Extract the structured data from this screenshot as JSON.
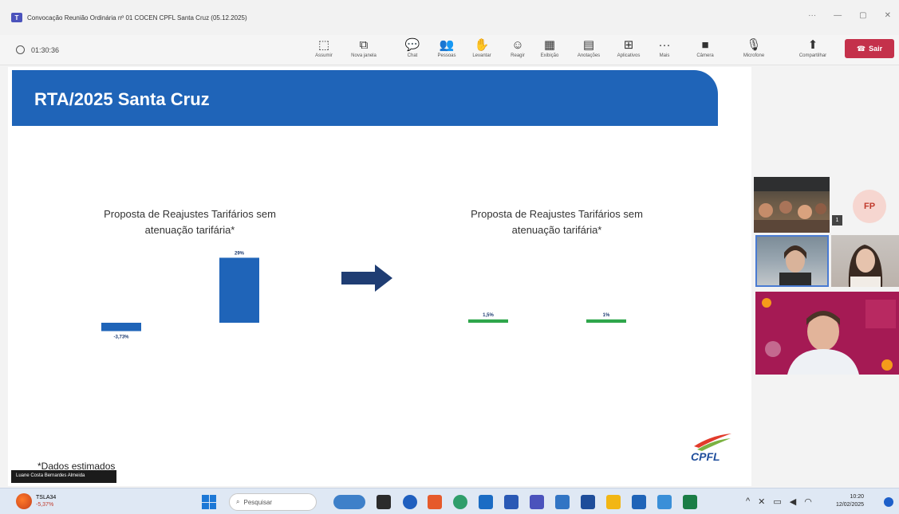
{
  "window": {
    "title": "Convocação Reunião Ordinária nº 01 COCEN CPFL Santa Cruz (05.12.2025)"
  },
  "toolbar": {
    "timer": "01:30:36",
    "items": [
      {
        "label": "Assumir",
        "icon": "share-screen-icon",
        "glyph": "⬚"
      },
      {
        "label": "Nova janela",
        "icon": "new-window-icon",
        "glyph": "⧉"
      },
      {
        "label": "Chat",
        "icon": "chat-icon",
        "glyph": "💬"
      },
      {
        "label": "Pessoas",
        "icon": "people-icon",
        "glyph": "👥"
      },
      {
        "label": "Levantar",
        "icon": "raise-hand-icon",
        "glyph": "✋"
      },
      {
        "label": "Reagir",
        "icon": "react-icon",
        "glyph": "☺"
      },
      {
        "label": "Exibição",
        "icon": "view-icon",
        "glyph": "▦"
      },
      {
        "label": "Anotações",
        "icon": "notes-icon",
        "glyph": "▤"
      },
      {
        "label": "Aplicativos",
        "icon": "apps-icon",
        "glyph": "⊞"
      },
      {
        "label": "Mais",
        "icon": "more-icon",
        "glyph": "···"
      },
      {
        "label": "Câmera",
        "icon": "camera-icon",
        "glyph": "■"
      },
      {
        "label": "Microfone",
        "icon": "microphone-icon",
        "glyph": "🎙"
      },
      {
        "label": "Compartilhar",
        "icon": "share-icon",
        "glyph": "⬆"
      }
    ],
    "leave_label": "Sair"
  },
  "slide": {
    "title": "RTA/2025 Santa Cruz",
    "footnote": "*Dados estimados"
  },
  "chart_data": [
    {
      "type": "bar",
      "title_line1": "Proposta de Reajustes Tarifários sem",
      "title_line2": "atenuação tarifária*",
      "categories": [
        "",
        ""
      ],
      "values": [
        -3.73,
        29
      ],
      "value_labels": [
        "-3,73%",
        "29%"
      ],
      "colors": [
        "#1f64b8",
        "#1f64b8"
      ],
      "ylim": [
        -6,
        32
      ]
    },
    {
      "type": "bar",
      "title_line1": "Proposta de Reajustes Tarifários sem",
      "title_line2": "atenuação tarifária*",
      "categories": [
        "",
        ""
      ],
      "values": [
        1.5,
        1.5
      ],
      "value_labels": [
        "1,5%",
        "1%"
      ],
      "colors": [
        "#2fa64b",
        "#2fa64b"
      ],
      "ylim": [
        -6,
        32
      ]
    }
  ],
  "caption": {
    "text": "Luane Costa Bernardes Almeida"
  },
  "video": {
    "initials": "FP",
    "badge": "1"
  },
  "taskbar": {
    "weather_temp": "TSLA34",
    "weather_change": "-5,37%",
    "search_placeholder": "Pesquisar",
    "time": "10:20",
    "date": "12/02/2025"
  },
  "colors": {
    "header_blue": "#1f64b8",
    "leave_red": "#c4314b",
    "bar_green": "#2fa64b",
    "arrow_navy": "#1f3d73"
  }
}
